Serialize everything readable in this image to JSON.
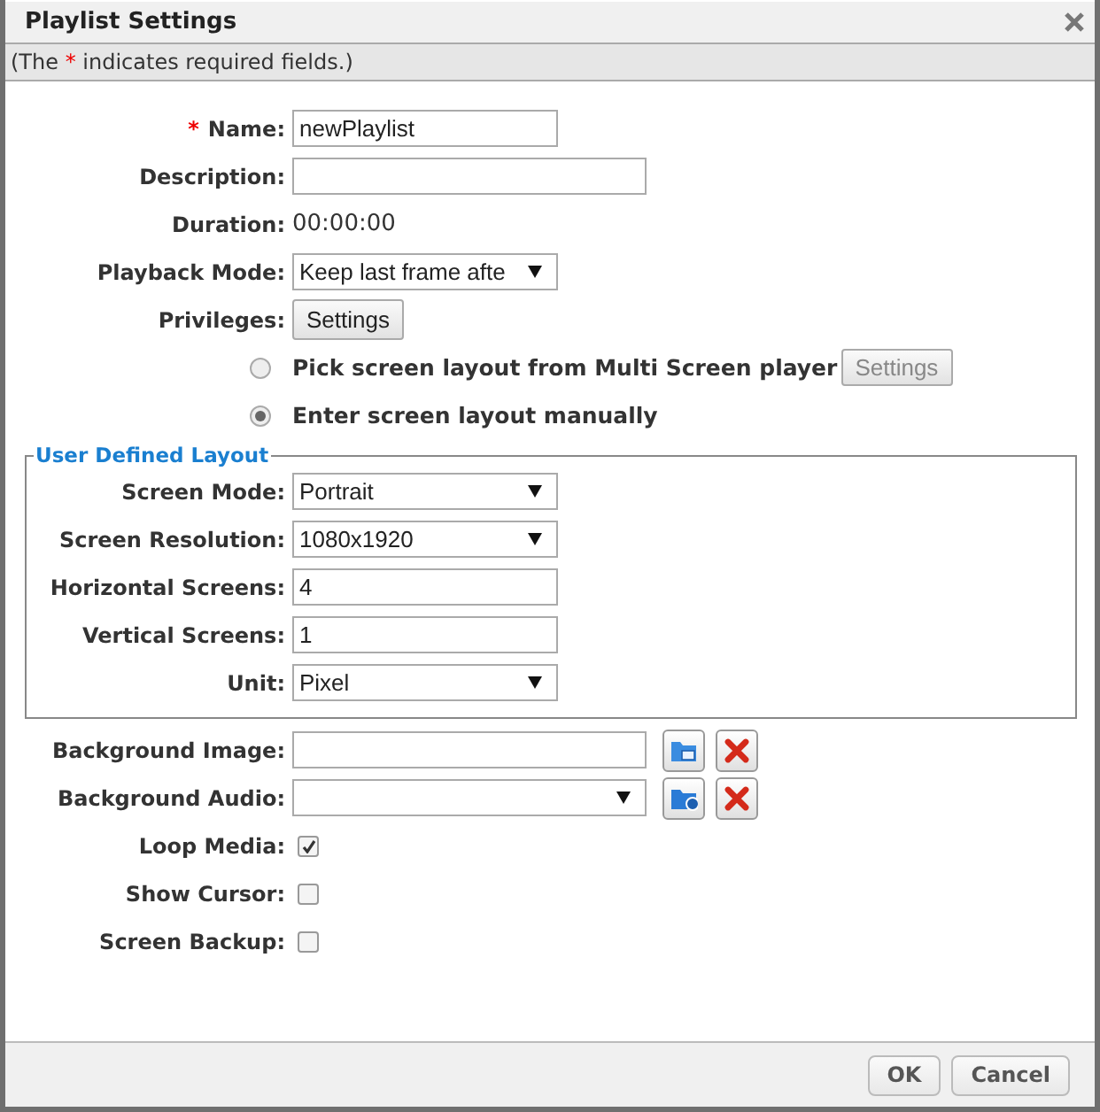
{
  "dialog": {
    "title": "Playlist Settings"
  },
  "notice": {
    "before": "(The ",
    "mark": "*",
    "after": " indicates required fields.)"
  },
  "fields": [
    {
      "kind": "text",
      "label": "Name:",
      "required": true,
      "value": "newPlaylist"
    },
    {
      "kind": "wide-text",
      "label": "Description:",
      "required": false
    },
    {
      "kind": "static",
      "label": "Duration:",
      "required": false,
      "value": "00:00:00"
    },
    {
      "kind": "select",
      "label": "Playback Mode:",
      "required": false,
      "value": "Keep last frame afte"
    },
    {
      "kind": "button",
      "label": "Privileges:",
      "required": false,
      "button": "Settings"
    },
    {
      "kind": "radio",
      "label": "Pick screen layout from Multi Screen player",
      "selected": false,
      "button": {
        "label": "Settings",
        "disabled": true
      }
    },
    {
      "kind": "radio",
      "label": "Enter screen layout manually",
      "selected": true
    }
  ],
  "layout": {
    "legend": "User Defined Layout",
    "fields": [
      {
        "kind": "select",
        "label": "Screen Mode:",
        "value": "Portrait"
      },
      {
        "kind": "select",
        "label": "Screen Resolution:",
        "value": "1080x1920"
      },
      {
        "kind": "text",
        "label": "Horizontal Screens:",
        "value": "4"
      },
      {
        "kind": "text",
        "label": "Vertical Screens:",
        "value": "1"
      },
      {
        "kind": "select",
        "label": "Unit:",
        "value": "Pixel"
      }
    ]
  },
  "media": [
    {
      "kind": "file",
      "label": "Background Image:"
    },
    {
      "kind": "file-select",
      "label": "Background Audio:"
    },
    {
      "kind": "checkbox",
      "label": "Loop Media:",
      "checked": true
    },
    {
      "kind": "checkbox",
      "label": "Show Cursor:",
      "checked": false
    },
    {
      "kind": "checkbox",
      "label": "Screen Backup:",
      "checked": false
    }
  ],
  "buttons": [
    "OK",
    "Cancel"
  ]
}
